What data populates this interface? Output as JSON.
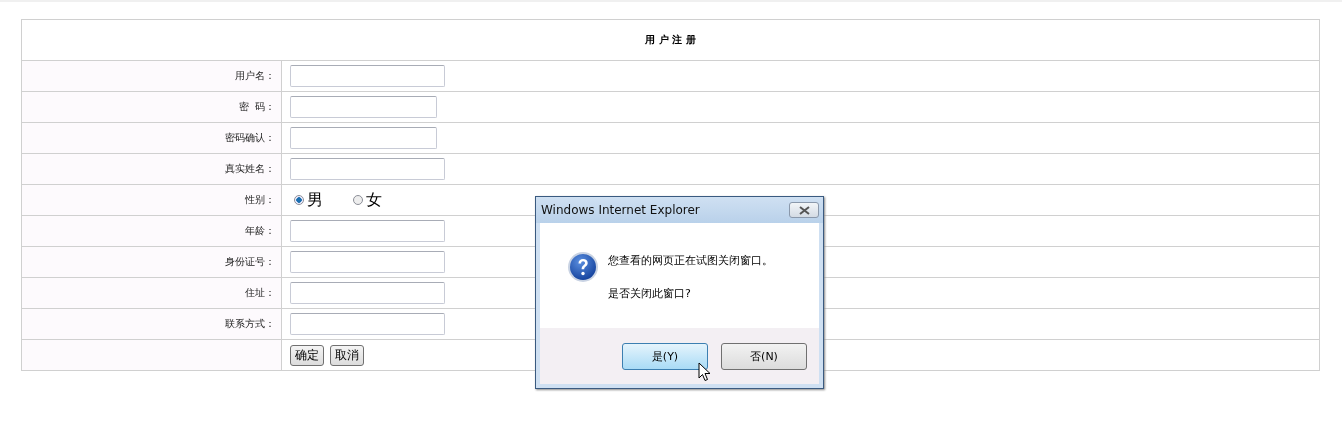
{
  "form": {
    "title": "用 户 注 册",
    "rows": [
      {
        "kind": "text",
        "label": "用户名："
      },
      {
        "kind": "password",
        "label": "密  码："
      },
      {
        "kind": "password",
        "label": "密码确认："
      },
      {
        "kind": "text",
        "label": "真实姓名："
      },
      {
        "kind": "radio",
        "label": "性别：",
        "options": [
          {
            "label": "男",
            "selected": true
          },
          {
            "label": "女",
            "selected": false
          }
        ]
      },
      {
        "kind": "text",
        "label": "年龄："
      },
      {
        "kind": "text",
        "label": "身份证号："
      },
      {
        "kind": "text",
        "label": "住址："
      },
      {
        "kind": "text",
        "label": "联系方式："
      },
      {
        "kind": "buttons",
        "buttons": [
          "确定",
          "取消"
        ]
      }
    ]
  },
  "dialog": {
    "title": "Windows Internet Explorer",
    "message": "您查看的网页正在试图关闭窗口。",
    "question": "是否关闭此窗口?",
    "buttons": [
      {
        "label": "是(Y)",
        "selected": true
      },
      {
        "label": "否(N)",
        "selected": false
      }
    ]
  }
}
